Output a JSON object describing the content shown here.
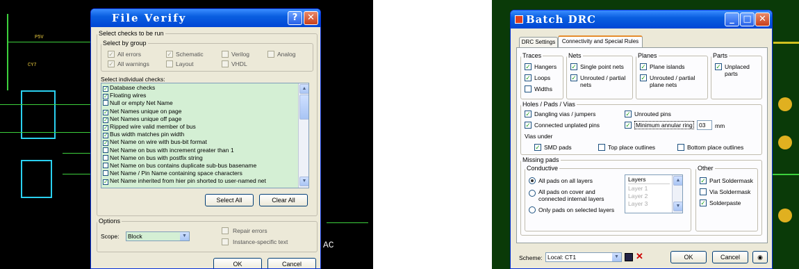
{
  "file_verify": {
    "title": "File Verify",
    "help_icon": "question-icon",
    "close_icon": "close-icon",
    "select_checks_legend": "Select checks to be run",
    "select_by_group_legend": "Select by group",
    "groups": [
      "All errors",
      "Schematic",
      "Verilog",
      "Analog",
      "All warnings",
      "Layout",
      "VHDL"
    ],
    "individual_label": "Select individual checks:",
    "checks": [
      {
        "label": "Database checks",
        "checked": true
      },
      {
        "label": "Floating wires",
        "checked": true
      },
      {
        "label": "Null or empty Net Name",
        "checked": false
      },
      {
        "label": "Net Names unique on page",
        "checked": true
      },
      {
        "label": "Net Names unique off page",
        "checked": true
      },
      {
        "label": "Ripped wire valid member of bus",
        "checked": true
      },
      {
        "label": "Bus width matches pin width",
        "checked": true
      },
      {
        "label": "Net Name on wire with bus-bit format",
        "checked": true
      },
      {
        "label": "Net Name on bus with increment greater than 1",
        "checked": false
      },
      {
        "label": "Net Name on bus with postfix string",
        "checked": false
      },
      {
        "label": "Net Name on bus contains duplicate sub-bus basename",
        "checked": false
      },
      {
        "label": "Net Name / Pin Name containing space characters",
        "checked": false
      },
      {
        "label": "Net Name inherited from hier pin shorted to user-named net",
        "checked": true
      }
    ],
    "select_all": "Select All",
    "clear_all": "Clear All",
    "options_legend": "Options",
    "scope_label": "Scope:",
    "scope_value": "Block",
    "repair_errors": "Repair errors",
    "instance_specific": "Instance-specific text",
    "ok": "OK",
    "cancel": "Cancel"
  },
  "batch_drc": {
    "title": "Batch DRC",
    "tabs": [
      "DRC Settings",
      "Connectivity and Special Rules"
    ],
    "traces_legend": "Traces",
    "traces": [
      {
        "label": "Hangers",
        "checked": true
      },
      {
        "label": "Loops",
        "checked": true
      },
      {
        "label": "Widths",
        "checked": false
      }
    ],
    "nets_legend": "Nets",
    "nets": [
      {
        "label": "Single point nets",
        "checked": true
      },
      {
        "label": "Unrouted / partial nets",
        "checked": true
      }
    ],
    "planes_legend": "Planes",
    "planes": [
      {
        "label": "Plane islands",
        "checked": true
      },
      {
        "label": "Unrouted / partial plane nets",
        "checked": true
      }
    ],
    "parts_legend": "Parts",
    "parts": [
      {
        "label": "Unplaced parts",
        "checked": true
      }
    ],
    "holes_legend": "Holes / Pads / Vias",
    "dangling": "Dangling vias / jumpers",
    "unrouted_pins": "Unrouted pins",
    "connected_unplated": "Connected unplated pins",
    "min_annular": "Minimum annular ring",
    "min_annular_value": "03",
    "min_annular_unit": "mm",
    "vias_under": "Vias under",
    "smd_pads": "SMD pads",
    "top_place": "Top place outlines",
    "bottom_place": "Bottom place outlines",
    "missing_pads_legend": "Missing pads",
    "conductive_legend": "Conductive",
    "all_pads": "All pads on all layers",
    "all_pads_cover": "All pads on cover and connected internal layers",
    "only_pads": "Only pads on selected layers",
    "layers_header": "Layers",
    "layer_items": [
      "Layer 1",
      "Layer 2",
      "Layer 3"
    ],
    "other_legend": "Other",
    "part_soldermask": "Part Soldermask",
    "via_soldermask": "Via Soldermask",
    "solderpaste": "Solderpaste",
    "scheme_label": "Scheme:",
    "scheme_value": "Local: CT1",
    "ok": "OK",
    "cancel": "Cancel"
  }
}
